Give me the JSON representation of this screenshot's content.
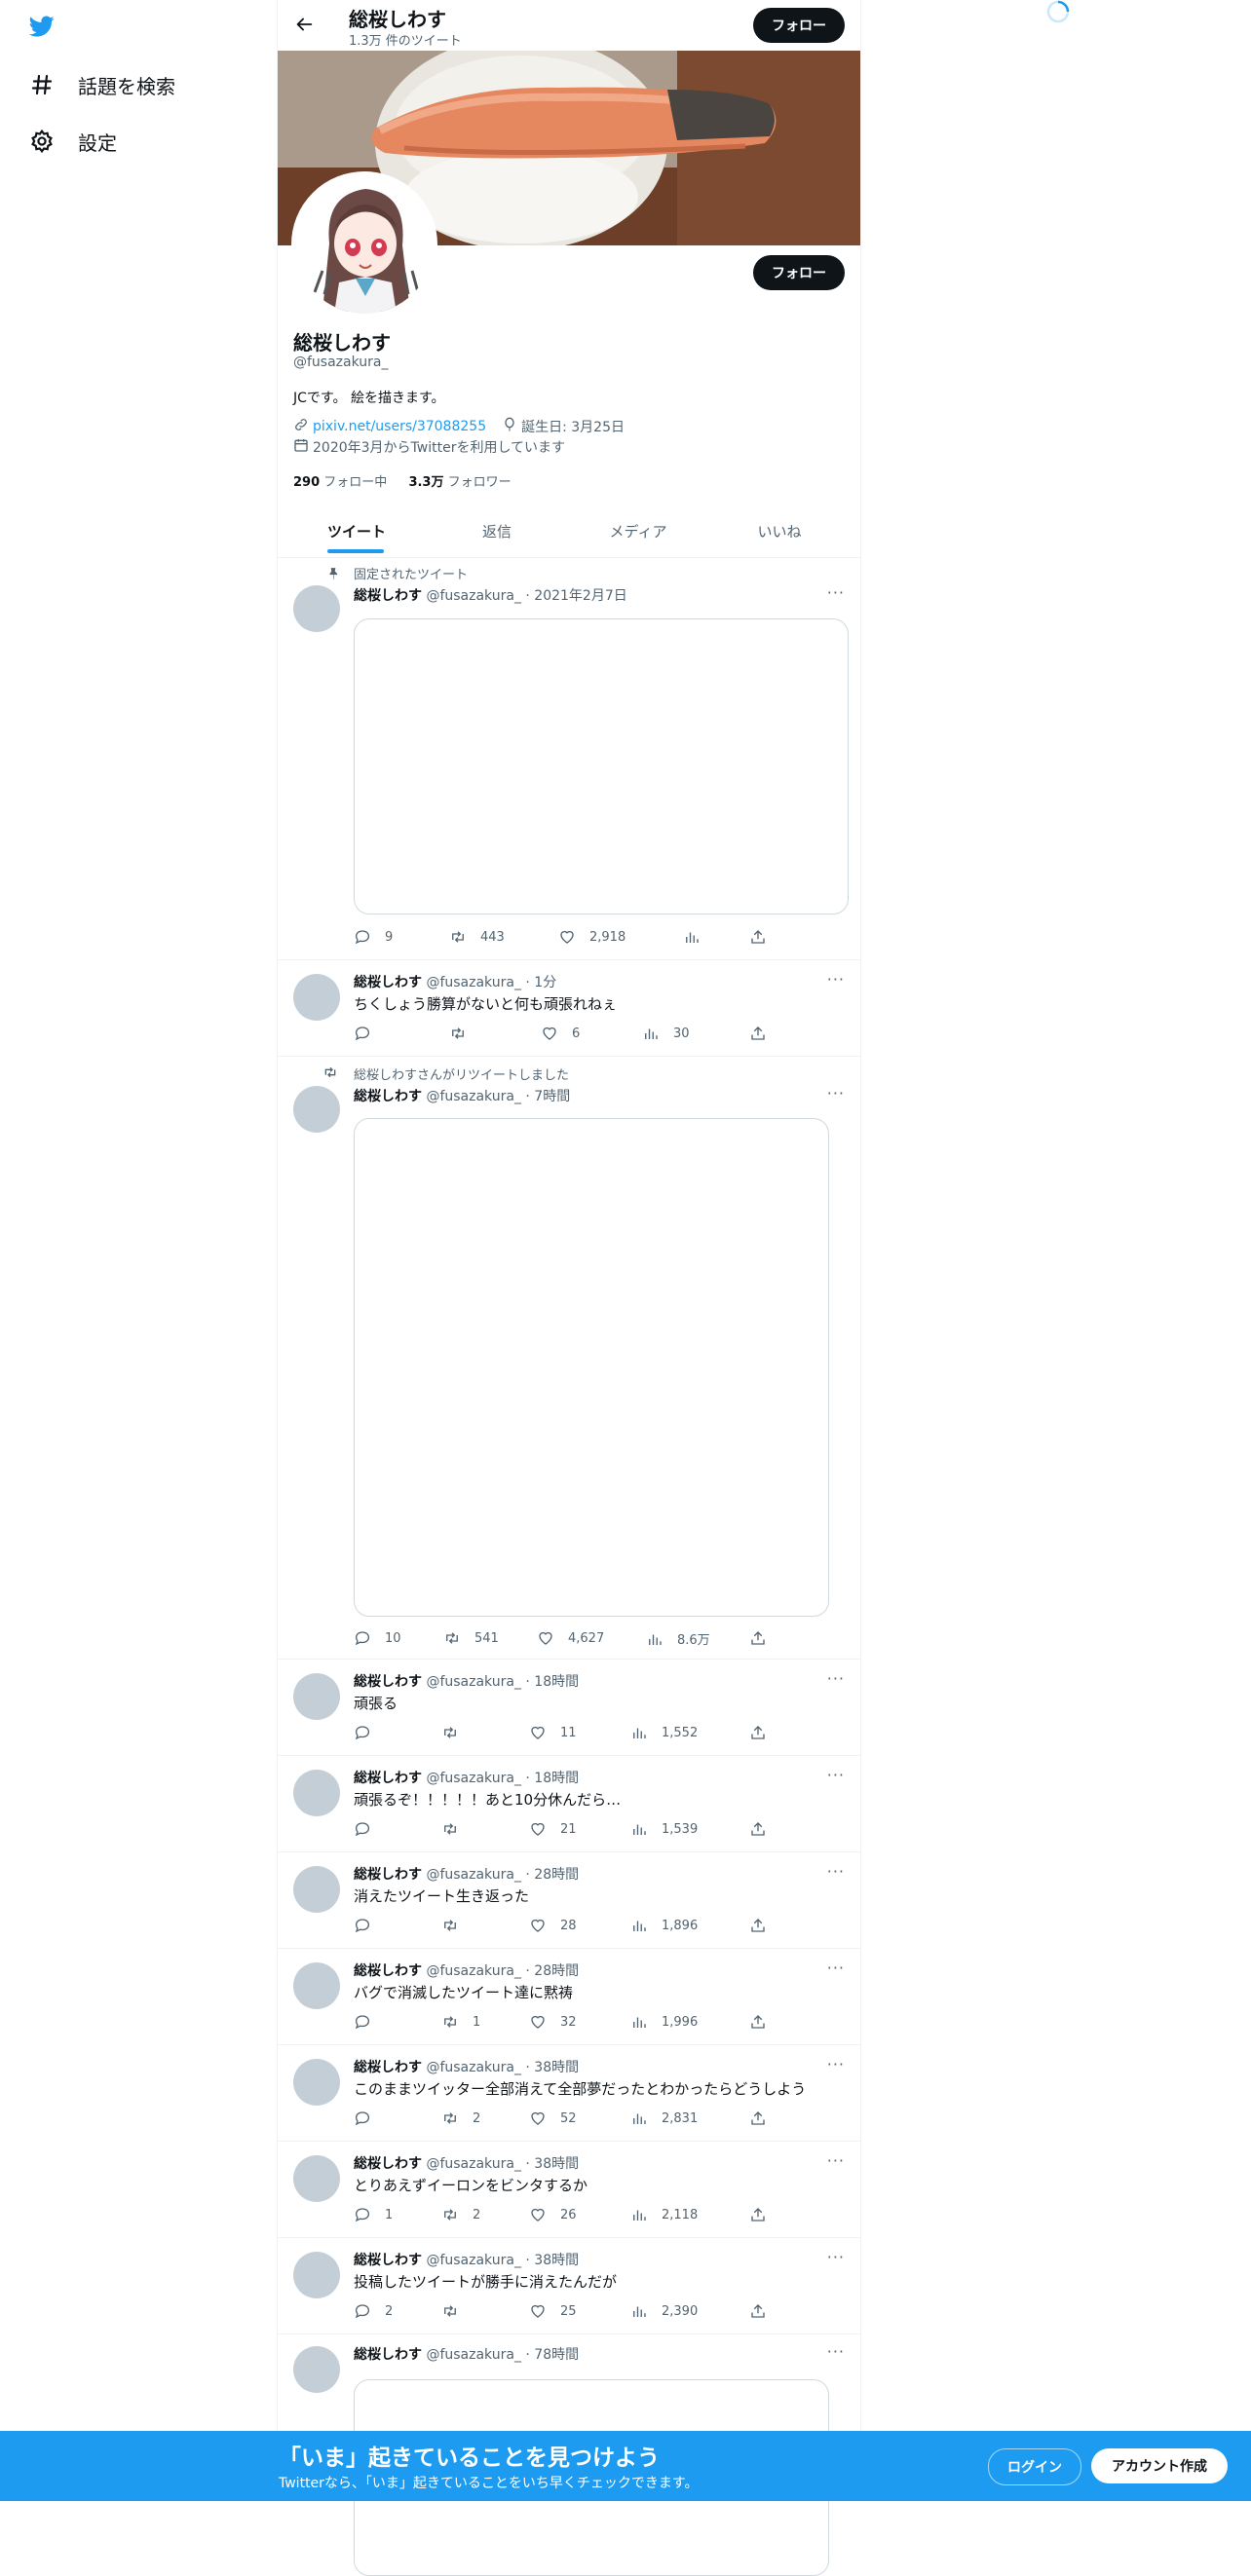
{
  "colors": {
    "brand": "#1d9bf0",
    "text": "#0f1419",
    "muted": "#536471",
    "follow_bg": "#0f1419"
  },
  "nav": {
    "logo": "twitter-bird-icon",
    "items": [
      {
        "label": "話題を検索",
        "icon": "hashtag-icon"
      },
      {
        "label": "設定",
        "icon": "gear-icon"
      }
    ]
  },
  "header": {
    "title": "総桜しわす",
    "subtitle": "1.3万 件のツイート",
    "follow_label": "フォロー"
  },
  "profile": {
    "name": "総桜しわす",
    "handle": "@fusazakura_",
    "bio": "JCです。 絵を描きます。",
    "link": "pixiv.net/users/37088255",
    "birthday": "誕生日: 3月25日",
    "joined": "2020年3月からTwitterを利用しています",
    "following_count": "290",
    "following_label": "フォロー中",
    "followers_count": "3.3万",
    "followers_label": "フォロワー",
    "follow_label": "フォロー"
  },
  "tabs": [
    "ツイート",
    "返信",
    "メディア",
    "いいね"
  ],
  "active_tab": "ツイート",
  "tweets": [
    {
      "pinned_label": "固定されたツイート",
      "name": "総桜しわす",
      "meta": "@fusazakura_ · 2021年2月7日",
      "text": "",
      "reply": "9",
      "retweet": "443",
      "like": "2,918",
      "views": ""
    },
    {
      "name": "総桜しわす",
      "meta": "@fusazakura_ · 1分",
      "text": "ちくしょう勝算がないと何も頑張れねぇ",
      "reply": "",
      "retweet": "",
      "like": "6",
      "views": "30"
    },
    {
      "retweet_label": "総桜しわすさんがリツイートしました",
      "name": "総桜しわす",
      "meta": "@fusazakura_ · 7時間",
      "text": "",
      "reply": "10",
      "retweet": "541",
      "like": "4,627",
      "views": "8.6万"
    },
    {
      "name": "総桜しわす",
      "meta": "@fusazakura_ · 18時間",
      "text": "頑張る",
      "reply": "",
      "retweet": "",
      "like": "11",
      "views": "1,552"
    },
    {
      "name": "総桜しわす",
      "meta": "@fusazakura_ · 18時間",
      "text": "頑張るぞ！！！！！あと10分休んだら…",
      "reply": "",
      "retweet": "",
      "like": "21",
      "views": "1,539"
    },
    {
      "name": "総桜しわす",
      "meta": "@fusazakura_ · 28時間",
      "text": "消えたツイート生き返った",
      "reply": "",
      "retweet": "",
      "like": "28",
      "views": "1,896"
    },
    {
      "name": "総桜しわす",
      "meta": "@fusazakura_ · 28時間",
      "text": "バグで消滅したツイート達に黙祷",
      "reply": "",
      "retweet": "1",
      "like": "32",
      "views": "1,996"
    },
    {
      "name": "総桜しわす",
      "meta": "@fusazakura_ · 38時間",
      "text": "このままツイッター全部消えて全部夢だったとわかったらどうしよう",
      "reply": "",
      "retweet": "2",
      "like": "52",
      "views": "2,831"
    },
    {
      "name": "総桜しわす",
      "meta": "@fusazakura_ · 38時間",
      "text": "とりあえずイーロンをビンタするか",
      "reply": "1",
      "retweet": "2",
      "like": "26",
      "views": "2,118"
    },
    {
      "name": "総桜しわす",
      "meta": "@fusazakura_ · 38時間",
      "text": "投稿したツイートが勝手に消えたんだが",
      "reply": "2",
      "retweet": "",
      "like": "25",
      "views": "2,390"
    },
    {
      "name": "総桜しわす",
      "meta": "@fusazakura_ · 78時間",
      "text": ""
    }
  ],
  "more_icon": "···",
  "bottom_bar": {
    "title": "「いま」起きていることを見つけよう",
    "subtitle": "Twitterなら、「いま」起きていることをいち早くチェックできます。",
    "login_label": "ログイン",
    "signup_label": "アカウント作成"
  }
}
